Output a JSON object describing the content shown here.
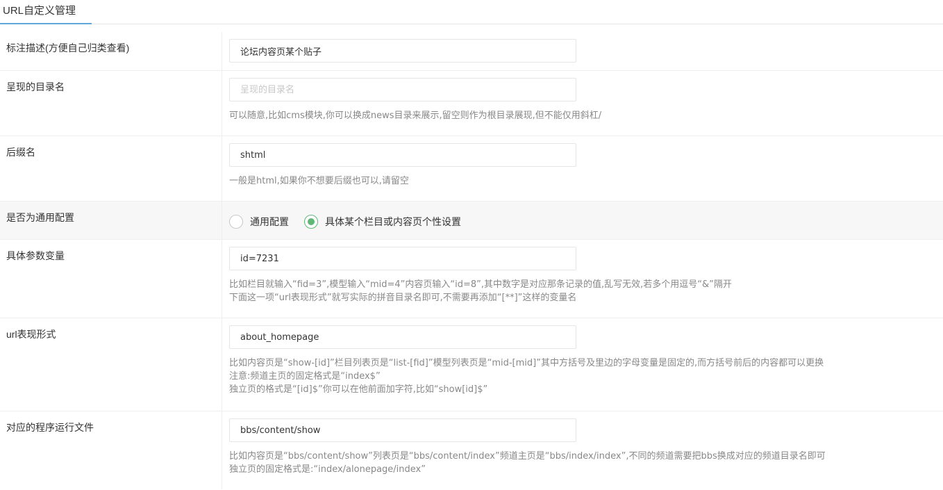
{
  "tabs": [
    {
      "label": "URL自定义管理",
      "active": true
    }
  ],
  "accent_color": "#5fa8dc",
  "radio_checked_color": "#5fb878",
  "form": {
    "description": {
      "label": "标注描述(方便自己归类查看)",
      "value": "论坛内容页某个贴子"
    },
    "dirname": {
      "label": "呈现的目录名",
      "value": "",
      "placeholder": "呈现的目录名",
      "hint": "可以随意,比如cms模块,你可以换成news目录来展示,留空则作为根目录展现,但不能仅用斜杠/"
    },
    "suffix": {
      "label": "后缀名",
      "value": "shtml",
      "hint": "一般是html,如果你不想要后缀也可以,请留空"
    },
    "general": {
      "label": "是否为通用配置",
      "options": [
        {
          "label": "通用配置",
          "checked": false
        },
        {
          "label": "具体某个栏目或内容页个性设置",
          "checked": true
        }
      ]
    },
    "params": {
      "label": "具体参数变量",
      "value": "id=7231",
      "hint_lines": [
        "比如栏目就输入“fid=3”,模型输入“mid=4”内容页输入“id=8”,其中数字是对应那条记录的值,乱写无效,若多个用逗号“&”隔开",
        "下面这一项“url表现形式”就写实际的拼音目录名即可,不需要再添加“[**]”这样的变量名"
      ]
    },
    "url_format": {
      "label": "url表现形式",
      "value": "about_homepage",
      "hint_lines": [
        "比如内容页是“show-[id]”栏目列表页是“list-[fid]”模型列表页是“mid-[mid]”其中方括号及里边的字母变量是固定的,而方括号前后的内容都可以更换",
        "注意:频道主页的固定格式是“index$”",
        "独立页的格式是“[id]$”你可以在他前面加字符,比如“show[id]$”"
      ]
    },
    "program": {
      "label": "对应的程序运行文件",
      "value": "bbs/content/show",
      "hint_lines": [
        "比如内容页是“bbs/content/show”列表页是“bbs/content/index”频道主页是“bbs/index/index”,不同的频道需要把bbs换成对应的频道目录名即可",
        "独立页的固定格式是:“index/alonepage/index”"
      ]
    }
  }
}
